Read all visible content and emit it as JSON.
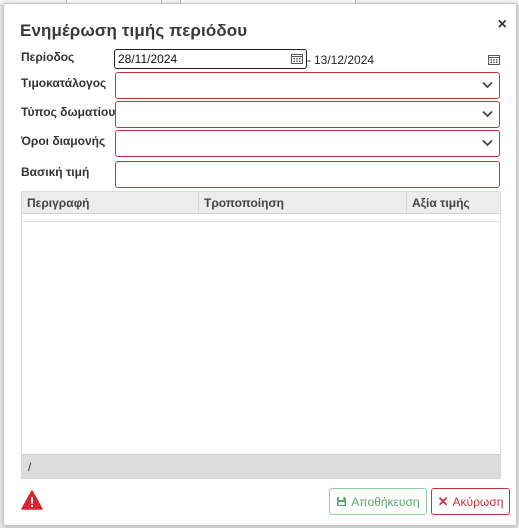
{
  "background": {
    "tab_label": "Όροι διαμονής"
  },
  "dialog": {
    "title": "Ενημέρωση τιμής περιόδου",
    "close_symbol": "×"
  },
  "form": {
    "period_label": "Περίοδος",
    "date_from": "28/11/2024",
    "date_separator": "-",
    "date_to": "13/12/2024",
    "pricelist_label": "Τιμοκατάλογος",
    "pricelist_value": "",
    "room_type_label": "Τύπος δωματίου",
    "room_type_value": "",
    "stay_terms_label": "Όροι διαμονής",
    "stay_terms_value": "",
    "base_price_label": "Βασική τιμή",
    "base_price_value": ""
  },
  "grid": {
    "columns": [
      "Περιγραφή",
      "Τροποποίηση",
      "Αξία τιμής"
    ],
    "rows": [],
    "footer": "/"
  },
  "buttons": {
    "save_label": "Αποθήκευση",
    "cancel_label": "Ακύρωση"
  },
  "colors": {
    "error_border": "#c8323c",
    "save_green": "#5aa66a",
    "warning_red": "#d9232e"
  },
  "icons": [
    "calendar-icon",
    "chevron-down-icon",
    "warning-icon",
    "save-icon",
    "close-icon"
  ]
}
